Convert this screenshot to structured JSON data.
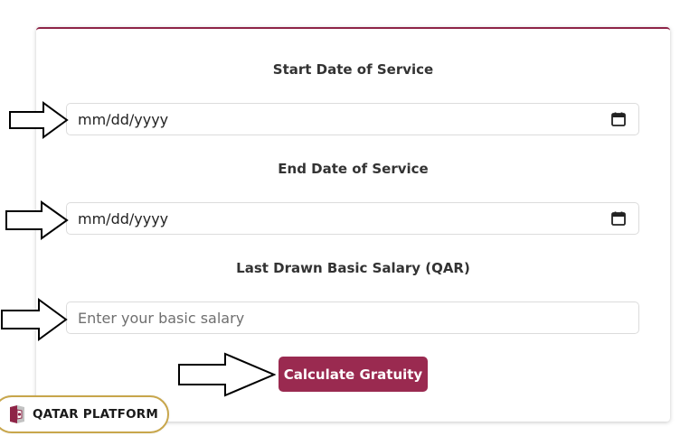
{
  "form": {
    "start_date": {
      "label": "Start Date of Service",
      "value": "mm/dd/yyyy"
    },
    "end_date": {
      "label": "End Date of Service",
      "value": "mm/dd/yyyy"
    },
    "salary": {
      "label": "Last Drawn Basic Salary (QAR)",
      "placeholder": "Enter your basic salary"
    },
    "submit_label": "Calculate Gratuity"
  },
  "badge": {
    "text": "QATAR PLATFORM"
  },
  "colors": {
    "accent": "#9a2a50",
    "badge_border": "#c8a64b"
  },
  "icons": {
    "date_picker": "calendar-icon",
    "pointer": "arrow-right-icon"
  }
}
